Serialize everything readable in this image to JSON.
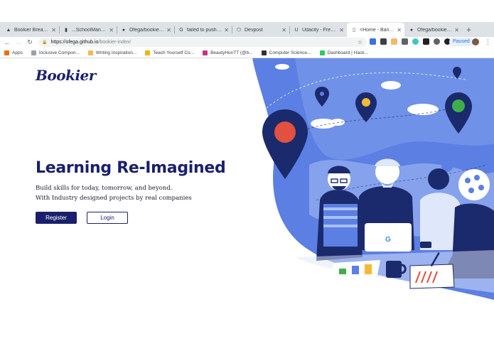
{
  "browser": {
    "tabs": [
      {
        "title": "Bookier Breakdow",
        "favicon": "layers-icon",
        "active": false
      },
      {
        "title": "...SchoolManager",
        "favicon": "bookmark-icon",
        "active": false
      },
      {
        "title": "Ofega/bookier-ind",
        "favicon": "github-icon",
        "active": false
      },
      {
        "title": "failed to push som",
        "favicon": "google-icon",
        "active": false
      },
      {
        "title": "Devpost",
        "favicon": "devpost-icon",
        "active": false
      },
      {
        "title": "Udacity - Free On",
        "favicon": "udacity-icon",
        "active": false
      },
      {
        "title": "<Home - Banner />",
        "favicon": "page-icon",
        "active": true
      },
      {
        "title": "Ofega/bookier-ind",
        "favicon": "github-icon",
        "active": false
      }
    ],
    "address": {
      "host": "https://ofega.github.io",
      "path": "/bookier-index/"
    },
    "paused_label": "Paused",
    "bookmarks": [
      {
        "label": "Apps",
        "icon": "apps-grid-icon",
        "color": "#e8710a"
      },
      {
        "label": "Inclusive Compon...",
        "icon": "bookmark-icon",
        "color": "#9aa0a6"
      },
      {
        "label": "Writing Inspiration...",
        "icon": "writing-icon",
        "color": "#f6b94d"
      },
      {
        "label": "Teach Yourself Co...",
        "icon": "key-icon",
        "color": "#f4b400"
      },
      {
        "label": "BeautyHunTT (@b...",
        "icon": "instagram-icon",
        "color": "#c13584"
      },
      {
        "label": "Computer Science...",
        "icon": "book-icon",
        "color": "#333333"
      },
      {
        "label": "Dashboard | Hack...",
        "icon": "hackerrank-icon",
        "color": "#2ec866"
      }
    ]
  },
  "page": {
    "logo": "Bookier",
    "hero_title": "Learning Re-Imagined",
    "hero_line1": "Build skills for today, tomorrow, and beyond.",
    "hero_line2": "With Industry designed projects by real companies",
    "register_label": "Register",
    "login_label": "Login",
    "laptop_logo": "G"
  },
  "colors": {
    "brand_navy": "#1a1f6b",
    "illustration_blue": "#5b7fe3",
    "illustration_light": "#a9c0f5",
    "pin_red": "#e2503f",
    "pin_yellow": "#f6b836",
    "pin_green": "#3fae4a"
  }
}
